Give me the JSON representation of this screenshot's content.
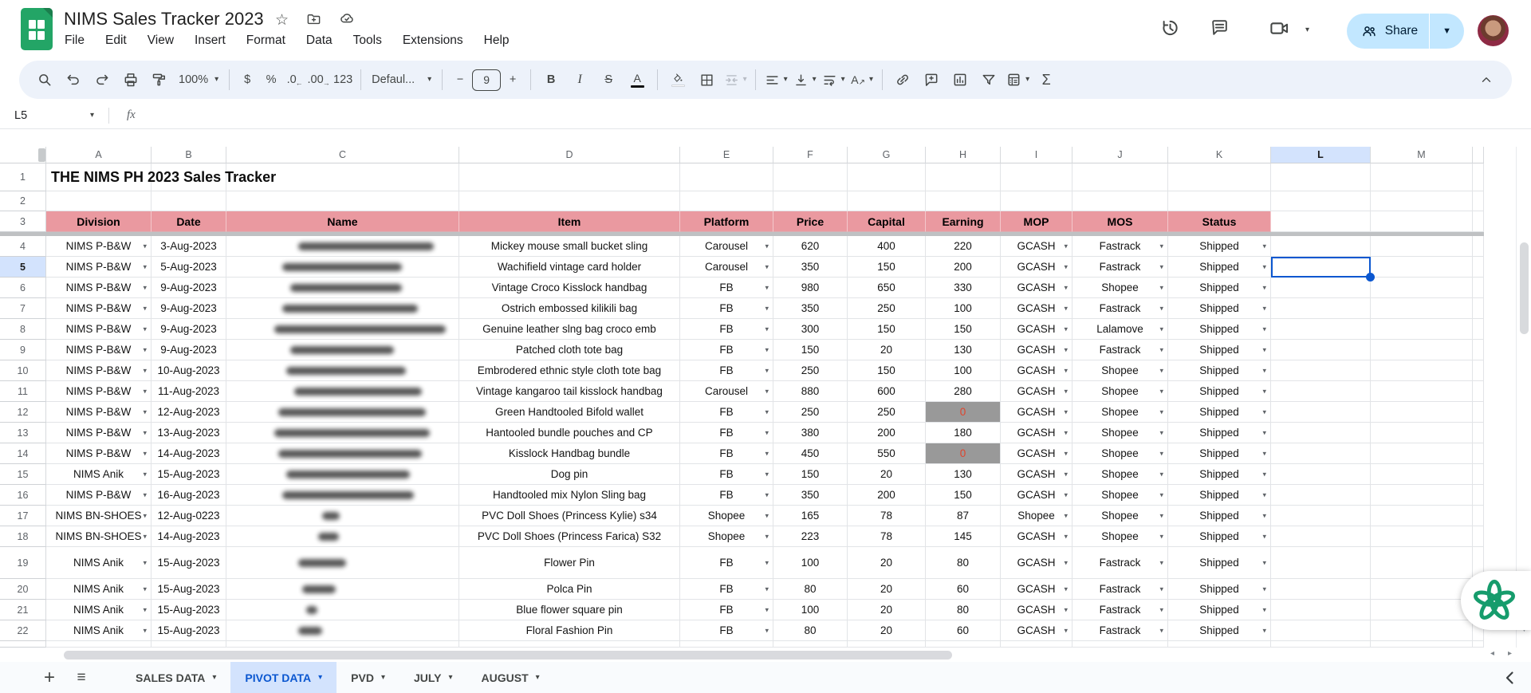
{
  "app": {
    "title": "NIMS Sales Tracker 2023",
    "menus": [
      "File",
      "Edit",
      "View",
      "Insert",
      "Format",
      "Data",
      "Tools",
      "Extensions",
      "Help"
    ]
  },
  "topright": {
    "share_label": "Share"
  },
  "toolbar": {
    "zoom": "100%",
    "font_name": "Defaul...",
    "font_size": "9",
    "dollar": "$",
    "percent": "%",
    "dec_down": ".0",
    "dec_up": ".00",
    "fmt123": "123",
    "bold": "B",
    "italic": "I",
    "strike": "S",
    "text_color": "A",
    "sigma": "Σ",
    "minus": "−",
    "plus": "+"
  },
  "formula_bar": {
    "cell_ref": "L5",
    "fx": "fx",
    "value": ""
  },
  "grid": {
    "columns": [
      "A",
      "B",
      "C",
      "D",
      "E",
      "F",
      "G",
      "H",
      "I",
      "J",
      "K",
      "L",
      "M"
    ],
    "row_count": 22,
    "title_cell": "THE NIMS PH 2023 Sales Tracker",
    "header_labels": [
      "Division",
      "Date",
      "Name",
      "Item",
      "Platform",
      "Price",
      "Capital",
      "Earning",
      "MOP",
      "MOS",
      "Status"
    ],
    "selection": {
      "ref": "L5",
      "row": 5,
      "col": "L"
    },
    "names_redacted": true,
    "rows": [
      {
        "n": 4,
        "division": "NIMS P-B&W",
        "date": "3-Aug-2023",
        "name": "",
        "item": "Mickey mouse small bucket sling",
        "platform": "Carousel",
        "price": "620",
        "capital": "400",
        "earning": "220",
        "zero": false,
        "mop": "GCASH",
        "mos": "Fastrack",
        "status": "Shipped"
      },
      {
        "n": 5,
        "division": "NIMS P-B&W",
        "date": "5-Aug-2023",
        "name": "",
        "item": "Wachifield vintage card holder",
        "platform": "Carousel",
        "price": "350",
        "capital": "150",
        "earning": "200",
        "zero": false,
        "mop": "GCASH",
        "mos": "Fastrack",
        "status": "Shipped"
      },
      {
        "n": 6,
        "division": "NIMS P-B&W",
        "date": "9-Aug-2023",
        "name": "",
        "item": "Vintage Croco Kisslock handbag",
        "platform": "FB",
        "price": "980",
        "capital": "650",
        "earning": "330",
        "zero": false,
        "mop": "GCASH",
        "mos": "Shopee",
        "status": "Shipped"
      },
      {
        "n": 7,
        "division": "NIMS P-B&W",
        "date": "9-Aug-2023",
        "name": "",
        "item": "Ostrich embossed kilikili bag",
        "platform": "FB",
        "price": "350",
        "capital": "250",
        "earning": "100",
        "zero": false,
        "mop": "GCASH",
        "mos": "Fastrack",
        "status": "Shipped"
      },
      {
        "n": 8,
        "division": "NIMS P-B&W",
        "date": "9-Aug-2023",
        "name": "",
        "item": "Genuine leather slng bag croco emb",
        "platform": "FB",
        "price": "300",
        "capital": "150",
        "earning": "150",
        "zero": false,
        "mop": "GCASH",
        "mos": "Lalamove",
        "status": "Shipped"
      },
      {
        "n": 9,
        "division": "NIMS P-B&W",
        "date": "9-Aug-2023",
        "name": "",
        "item": "Patched cloth tote bag",
        "platform": "FB",
        "price": "150",
        "capital": "20",
        "earning": "130",
        "zero": false,
        "mop": "GCASH",
        "mos": "Fastrack",
        "status": "Shipped"
      },
      {
        "n": 10,
        "division": "NIMS P-B&W",
        "date": "10-Aug-2023",
        "name": "",
        "item": "Embrodered ethnic style cloth tote bag",
        "platform": "FB",
        "price": "250",
        "capital": "150",
        "earning": "100",
        "zero": false,
        "mop": "GCASH",
        "mos": "Shopee",
        "status": "Shipped"
      },
      {
        "n": 11,
        "division": "NIMS P-B&W",
        "date": "11-Aug-2023",
        "name": "",
        "item": "Vintage kangaroo tail kisslock handbag",
        "platform": "Carousel",
        "price": "880",
        "capital": "600",
        "earning": "280",
        "zero": false,
        "mop": "GCASH",
        "mos": "Shopee",
        "status": "Shipped"
      },
      {
        "n": 12,
        "division": "NIMS P-B&W",
        "date": "12-Aug-2023",
        "name": "",
        "item": "Green Handtooled Bifold wallet",
        "platform": "FB",
        "price": "250",
        "capital": "250",
        "earning": "0",
        "zero": true,
        "mop": "GCASH",
        "mos": "Shopee",
        "status": "Shipped"
      },
      {
        "n": 13,
        "division": "NIMS P-B&W",
        "date": "13-Aug-2023",
        "name": "",
        "item": "Hantooled bundle pouches and CP",
        "platform": "FB",
        "price": "380",
        "capital": "200",
        "earning": "180",
        "zero": false,
        "mop": "GCASH",
        "mos": "Shopee",
        "status": "Shipped"
      },
      {
        "n": 14,
        "division": "NIMS P-B&W",
        "date": "14-Aug-2023",
        "name": "",
        "item": "Kisslock Handbag bundle",
        "platform": "FB",
        "price": "450",
        "capital": "550",
        "earning": "0",
        "zero": true,
        "mop": "GCASH",
        "mos": "Shopee",
        "status": "Shipped"
      },
      {
        "n": 15,
        "division": "NIMS Anik",
        "date": "15-Aug-2023",
        "name": "",
        "item": "Dog pin",
        "platform": "FB",
        "price": "150",
        "capital": "20",
        "earning": "130",
        "zero": false,
        "mop": "GCASH",
        "mos": "Shopee",
        "status": "Shipped"
      },
      {
        "n": 16,
        "division": "NIMS P-B&W",
        "date": "16-Aug-2023",
        "name": "",
        "item": "Handtooled mix Nylon Sling bag",
        "platform": "FB",
        "price": "350",
        "capital": "200",
        "earning": "150",
        "zero": false,
        "mop": "GCASH",
        "mos": "Shopee",
        "status": "Shipped"
      },
      {
        "n": 17,
        "division": "NIMS BN-SHOES",
        "date": "12-Aug-0223",
        "name": "",
        "item": "PVC Doll Shoes (Princess Kylie) s34",
        "platform": "Shopee",
        "price": "165",
        "capital": "78",
        "earning": "87",
        "zero": false,
        "mop": "Shopee",
        "mos": "Shopee",
        "status": "Shipped"
      },
      {
        "n": 18,
        "division": "NIMS BN-SHOES",
        "date": "14-Aug-2023",
        "name": "",
        "item": "PVC Doll Shoes (Princess Farica) S32",
        "platform": "Shopee",
        "price": "223",
        "capital": "78",
        "earning": "145",
        "zero": false,
        "mop": "GCASH",
        "mos": "Shopee",
        "status": "Shipped"
      },
      {
        "n": 19,
        "division": "NIMS Anik",
        "date": "15-Aug-2023",
        "name": "",
        "item": "Flower Pin",
        "platform": "FB",
        "price": "100",
        "capital": "20",
        "earning": "80",
        "zero": false,
        "mop": "GCASH",
        "mos": "Fastrack",
        "status": "Shipped"
      },
      {
        "n": 20,
        "division": "NIMS Anik",
        "date": "15-Aug-2023",
        "name": "",
        "item": "Polca Pin",
        "platform": "FB",
        "price": "80",
        "capital": "20",
        "earning": "60",
        "zero": false,
        "mop": "GCASH",
        "mos": "Fastrack",
        "status": "Shipped"
      },
      {
        "n": 21,
        "division": "NIMS Anik",
        "date": "15-Aug-2023",
        "name": "",
        "item": "Blue flower square pin",
        "platform": "FB",
        "price": "100",
        "capital": "20",
        "earning": "80",
        "zero": false,
        "mop": "GCASH",
        "mos": "Fastrack",
        "status": "Shipped"
      },
      {
        "n": 22,
        "division": "NIMS Anik",
        "date": "15-Aug-2023",
        "name": "",
        "item": "Floral Fashion Pin",
        "platform": "FB",
        "price": "80",
        "capital": "20",
        "earning": "60",
        "zero": false,
        "mop": "GCASH",
        "mos": "Fastrack",
        "status": "Shipped"
      }
    ]
  },
  "sheetbar": {
    "tabs": [
      {
        "label": "SALES DATA",
        "active": false
      },
      {
        "label": "PIVOT DATA",
        "active": true
      },
      {
        "label": "PVD",
        "active": false
      },
      {
        "label": "JULY",
        "active": false
      },
      {
        "label": "AUGUST",
        "active": false
      }
    ]
  },
  "colors": {
    "header_band": "#ea99a0",
    "selection_blue": "#0b57d0",
    "selected_header_bg": "#d3e3fd",
    "zero_cell_bg": "#999999",
    "zero_cell_text": "#e0442c",
    "active_tab_bg": "#d3e3fd",
    "active_tab_text": "#0b57d0",
    "toolbar_bg": "#edf2fa",
    "share_bg": "#c2e7ff",
    "logo_green": "#23a566",
    "extension_green": "#169c6c"
  }
}
